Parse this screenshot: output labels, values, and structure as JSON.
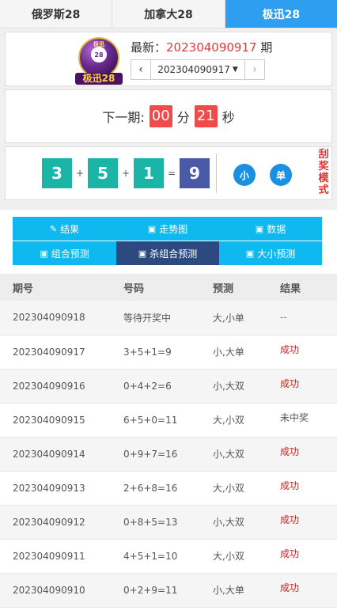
{
  "topnav": {
    "tabs": [
      {
        "label": "俄罗斯28",
        "active": false
      },
      {
        "label": "加拿大28",
        "active": false
      },
      {
        "label": "极迅28",
        "active": true
      }
    ]
  },
  "header": {
    "logo_text": "极迅28",
    "logo_ball_top": "极迅",
    "logo_ball_num": "28",
    "latest_label": "最新：",
    "latest_issue": "202304090917",
    "issue_suffix": "期",
    "selected_issue": "202304090917",
    "prev_icon": "‹",
    "next_icon": "›"
  },
  "countdown": {
    "label": "下一期:",
    "minutes": "00",
    "min_unit": "分",
    "seconds": "21",
    "sec_unit": "秒"
  },
  "result": {
    "d1": "3",
    "d2": "5",
    "d3": "1",
    "sum": "9",
    "plus": "+",
    "equals": "=",
    "size": "小",
    "parity": "单",
    "mode": "刮奖模式"
  },
  "tabs": [
    {
      "icon": "key-icon",
      "glyph": "✎",
      "label": "结果",
      "active": false
    },
    {
      "icon": "chart-icon",
      "glyph": "▣",
      "label": "走势图",
      "active": false
    },
    {
      "icon": "data-icon",
      "glyph": "▣",
      "label": "数据",
      "active": false
    },
    {
      "icon": "chart-icon",
      "glyph": "▣",
      "label": "组合预测",
      "active": false
    },
    {
      "icon": "chart-icon",
      "glyph": "▣",
      "label": "杀组合预测",
      "active": true
    },
    {
      "icon": "chart-icon",
      "glyph": "▣",
      "label": "大小预测",
      "active": false
    }
  ],
  "table": {
    "headers": [
      "期号",
      "号码",
      "预测",
      "结果"
    ],
    "rows": [
      {
        "issue": "202304090918",
        "numbers": "等待开奖中",
        "prediction": "大,小单",
        "result": "--",
        "status": "dash"
      },
      {
        "issue": "202304090917",
        "numbers": "3+5+1=9",
        "prediction": "小,大单",
        "result": "成功",
        "status": "ok"
      },
      {
        "issue": "202304090916",
        "numbers": "0+4+2=6",
        "prediction": "小,大双",
        "result": "成功",
        "status": "ok"
      },
      {
        "issue": "202304090915",
        "numbers": "6+5+0=11",
        "prediction": "大,小双",
        "result": "未中奖",
        "status": "miss"
      },
      {
        "issue": "202304090914",
        "numbers": "0+9+7=16",
        "prediction": "小,大双",
        "result": "成功",
        "status": "ok"
      },
      {
        "issue": "202304090913",
        "numbers": "2+6+8=16",
        "prediction": "大,小双",
        "result": "成功",
        "status": "ok"
      },
      {
        "issue": "202304090912",
        "numbers": "0+8+5=13",
        "prediction": "小,大双",
        "result": "成功",
        "status": "ok"
      },
      {
        "issue": "202304090911",
        "numbers": "4+5+1=10",
        "prediction": "大,小双",
        "result": "成功",
        "status": "ok"
      },
      {
        "issue": "202304090910",
        "numbers": "0+2+9=11",
        "prediction": "小,大单",
        "result": "成功",
        "status": "ok"
      }
    ]
  },
  "colors": {
    "accent": "#2e9ef0",
    "tab": "#10b8f0",
    "tab_active": "#2c4a80",
    "digit": "#1bb5a8",
    "sum": "#4a5aa8",
    "success": "#d21e1e",
    "countdown": "#f04a4a"
  }
}
